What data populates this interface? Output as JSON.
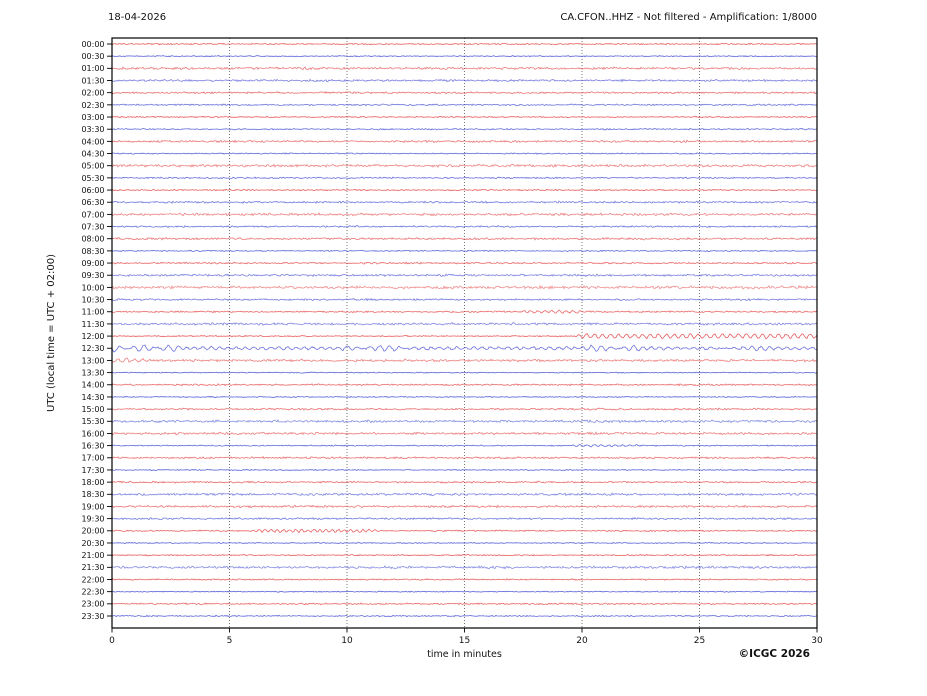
{
  "header": {
    "date": "18-04-2026",
    "title": "CA.CFON..HHZ - Not filtered - Amplification: 1/8000"
  },
  "footer": {
    "xlabel": "time in minutes",
    "copyright": "©ICGC 2026"
  },
  "chart_data": {
    "type": "line",
    "subtype": "helicorder-daily-seismogram",
    "title": "CA.CFON..HHZ - Not filtered - Amplification: 1/8000",
    "date": "18-04-2026",
    "xlabel": "time in minutes",
    "ylabel": "UTC (local time = UTC + 02:00)",
    "xlim": [
      0,
      30
    ],
    "x_ticks": [
      0,
      5,
      10,
      15,
      20,
      25,
      30
    ],
    "row_interval_minutes": 30,
    "grid": {
      "style": "vertical-dotted",
      "every_minutes": 5,
      "color": "#666666"
    },
    "colors": {
      "red": "#e23535",
      "blue": "#3943cf",
      "frame": "#000000"
    },
    "rows": [
      {
        "time": "00:00",
        "color": "red",
        "noise": 0.7,
        "events": []
      },
      {
        "time": "00:30",
        "color": "blue",
        "noise": 0.5,
        "events": []
      },
      {
        "time": "01:00",
        "color": "red",
        "noise": 1.1,
        "events": []
      },
      {
        "time": "01:30",
        "color": "blue",
        "noise": 1.0,
        "events": []
      },
      {
        "time": "02:00",
        "color": "red",
        "noise": 0.9,
        "events": []
      },
      {
        "time": "02:30",
        "color": "blue",
        "noise": 0.8,
        "events": []
      },
      {
        "time": "03:00",
        "color": "red",
        "noise": 0.6,
        "events": [
          {
            "s": 3.85,
            "e": 4.15,
            "a": 2.4,
            "p": 0
          }
        ]
      },
      {
        "time": "03:30",
        "color": "blue",
        "noise": 0.7,
        "events": []
      },
      {
        "time": "04:00",
        "color": "red",
        "noise": 1.0,
        "events": []
      },
      {
        "time": "04:30",
        "color": "blue",
        "noise": 0.6,
        "events": []
      },
      {
        "time": "05:00",
        "color": "red",
        "noise": 1.2,
        "events": []
      },
      {
        "time": "05:30",
        "color": "blue",
        "noise": 0.7,
        "events": []
      },
      {
        "time": "06:00",
        "color": "red",
        "noise": 0.6,
        "events": []
      },
      {
        "time": "06:30",
        "color": "blue",
        "noise": 0.9,
        "events": []
      },
      {
        "time": "07:00",
        "color": "red",
        "noise": 1.2,
        "events": []
      },
      {
        "time": "07:30",
        "color": "blue",
        "noise": 0.8,
        "events": []
      },
      {
        "time": "08:00",
        "color": "red",
        "noise": 1.0,
        "events": []
      },
      {
        "time": "08:30",
        "color": "blue",
        "noise": 0.6,
        "events": []
      },
      {
        "time": "09:00",
        "color": "red",
        "noise": 0.8,
        "events": []
      },
      {
        "time": "09:30",
        "color": "blue",
        "noise": 1.0,
        "events": []
      },
      {
        "time": "10:00",
        "color": "red",
        "noise": 1.4,
        "events": []
      },
      {
        "time": "10:30",
        "color": "blue",
        "noise": 0.9,
        "events": []
      },
      {
        "time": "11:00",
        "color": "red",
        "noise": 0.8,
        "events": [
          {
            "s": 17.3,
            "e": 20.3,
            "a": 1.1,
            "p": 0.3
          }
        ]
      },
      {
        "time": "11:30",
        "color": "blue",
        "noise": 1.1,
        "events": []
      },
      {
        "time": "12:00",
        "color": "red",
        "noise": 0.6,
        "events": [
          {
            "s": 19.6,
            "e": 30,
            "a": 2.0,
            "p": 0.34
          }
        ]
      },
      {
        "time": "12:30",
        "color": "blue",
        "noise": 0.8,
        "events": [
          {
            "s": 0,
            "e": 30,
            "a": 1.1,
            "p": 0.36
          },
          {
            "s": 0,
            "e": 3.2,
            "a": 2.0,
            "p": 0.5
          },
          {
            "s": 9.7,
            "e": 12.8,
            "a": 1.7,
            "p": 0.45
          },
          {
            "s": 19.6,
            "e": 22.8,
            "a": 1.5,
            "p": 0.45
          },
          {
            "s": 25.3,
            "e": 28.2,
            "a": 1.1,
            "p": 0.4
          }
        ]
      },
      {
        "time": "13:00",
        "color": "red",
        "noise": 1.2,
        "events": [
          {
            "s": 0,
            "e": 1.8,
            "a": 1.5,
            "p": 0.35
          }
        ]
      },
      {
        "time": "13:30",
        "color": "blue",
        "noise": 0.5,
        "events": []
      },
      {
        "time": "14:00",
        "color": "red",
        "noise": 0.8,
        "events": []
      },
      {
        "time": "14:30",
        "color": "blue",
        "noise": 0.5,
        "events": []
      },
      {
        "time": "15:00",
        "color": "red",
        "noise": 0.9,
        "events": []
      },
      {
        "time": "15:30",
        "color": "blue",
        "noise": 1.2,
        "events": []
      },
      {
        "time": "16:00",
        "color": "red",
        "noise": 1.1,
        "events": []
      },
      {
        "time": "16:30",
        "color": "blue",
        "noise": 0.6,
        "events": [
          {
            "s": 19.4,
            "e": 22.6,
            "a": 0.8,
            "p": 0.3
          }
        ]
      },
      {
        "time": "17:00",
        "color": "red",
        "noise": 0.9,
        "events": []
      },
      {
        "time": "17:30",
        "color": "blue",
        "noise": 0.5,
        "events": []
      },
      {
        "time": "18:00",
        "color": "red",
        "noise": 0.8,
        "events": []
      },
      {
        "time": "18:30",
        "color": "blue",
        "noise": 1.1,
        "events": []
      },
      {
        "time": "19:00",
        "color": "red",
        "noise": 1.0,
        "events": []
      },
      {
        "time": "19:30",
        "color": "blue",
        "noise": 0.9,
        "events": []
      },
      {
        "time": "20:00",
        "color": "red",
        "noise": 0.7,
        "events": [
          {
            "s": 5.8,
            "e": 11.6,
            "a": 1.3,
            "p": 0.26
          }
        ]
      },
      {
        "time": "20:30",
        "color": "blue",
        "noise": 0.5,
        "events": []
      },
      {
        "time": "21:00",
        "color": "red",
        "noise": 0.6,
        "events": []
      },
      {
        "time": "21:30",
        "color": "blue",
        "noise": 1.2,
        "events": []
      },
      {
        "time": "22:00",
        "color": "red",
        "noise": 0.7,
        "events": []
      },
      {
        "time": "22:30",
        "color": "blue",
        "noise": 0.5,
        "events": []
      },
      {
        "time": "23:00",
        "color": "red",
        "noise": 0.8,
        "events": []
      },
      {
        "time": "23:30",
        "color": "blue",
        "noise": 0.6,
        "events": []
      }
    ]
  }
}
